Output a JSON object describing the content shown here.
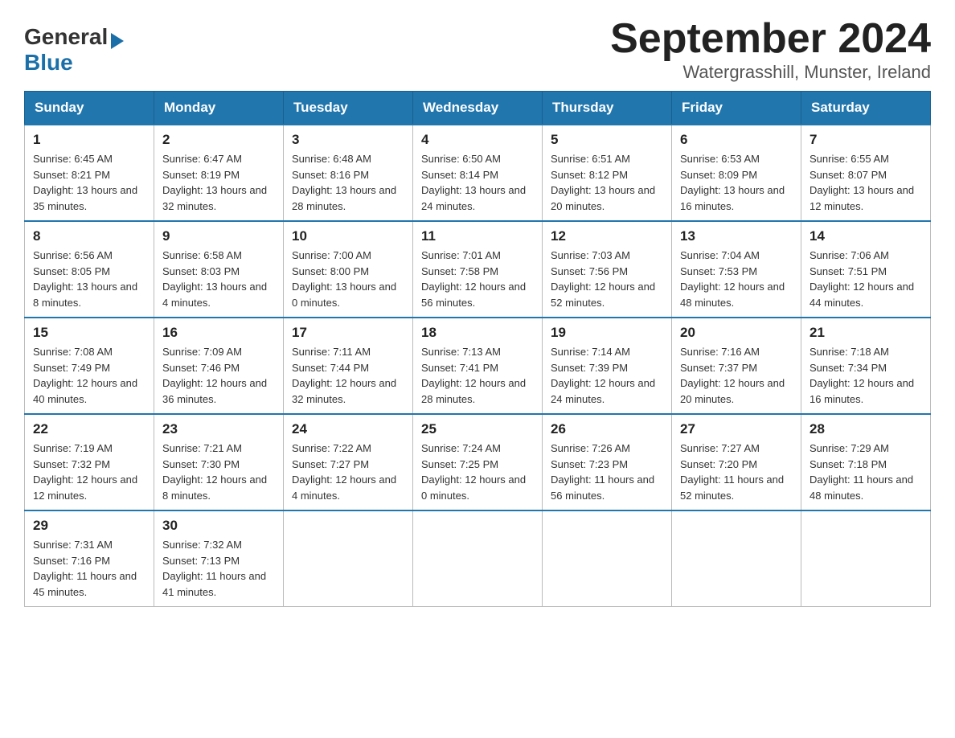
{
  "logo": {
    "general": "General",
    "blue": "Blue"
  },
  "title": "September 2024",
  "subtitle": "Watergrasshill, Munster, Ireland",
  "headers": [
    "Sunday",
    "Monday",
    "Tuesday",
    "Wednesday",
    "Thursday",
    "Friday",
    "Saturday"
  ],
  "weeks": [
    [
      {
        "day": "1",
        "sunrise": "6:45 AM",
        "sunset": "8:21 PM",
        "daylight": "13 hours and 35 minutes."
      },
      {
        "day": "2",
        "sunrise": "6:47 AM",
        "sunset": "8:19 PM",
        "daylight": "13 hours and 32 minutes."
      },
      {
        "day": "3",
        "sunrise": "6:48 AM",
        "sunset": "8:16 PM",
        "daylight": "13 hours and 28 minutes."
      },
      {
        "day": "4",
        "sunrise": "6:50 AM",
        "sunset": "8:14 PM",
        "daylight": "13 hours and 24 minutes."
      },
      {
        "day": "5",
        "sunrise": "6:51 AM",
        "sunset": "8:12 PM",
        "daylight": "13 hours and 20 minutes."
      },
      {
        "day": "6",
        "sunrise": "6:53 AM",
        "sunset": "8:09 PM",
        "daylight": "13 hours and 16 minutes."
      },
      {
        "day": "7",
        "sunrise": "6:55 AM",
        "sunset": "8:07 PM",
        "daylight": "13 hours and 12 minutes."
      }
    ],
    [
      {
        "day": "8",
        "sunrise": "6:56 AM",
        "sunset": "8:05 PM",
        "daylight": "13 hours and 8 minutes."
      },
      {
        "day": "9",
        "sunrise": "6:58 AM",
        "sunset": "8:03 PM",
        "daylight": "13 hours and 4 minutes."
      },
      {
        "day": "10",
        "sunrise": "7:00 AM",
        "sunset": "8:00 PM",
        "daylight": "13 hours and 0 minutes."
      },
      {
        "day": "11",
        "sunrise": "7:01 AM",
        "sunset": "7:58 PM",
        "daylight": "12 hours and 56 minutes."
      },
      {
        "day": "12",
        "sunrise": "7:03 AM",
        "sunset": "7:56 PM",
        "daylight": "12 hours and 52 minutes."
      },
      {
        "day": "13",
        "sunrise": "7:04 AM",
        "sunset": "7:53 PM",
        "daylight": "12 hours and 48 minutes."
      },
      {
        "day": "14",
        "sunrise": "7:06 AM",
        "sunset": "7:51 PM",
        "daylight": "12 hours and 44 minutes."
      }
    ],
    [
      {
        "day": "15",
        "sunrise": "7:08 AM",
        "sunset": "7:49 PM",
        "daylight": "12 hours and 40 minutes."
      },
      {
        "day": "16",
        "sunrise": "7:09 AM",
        "sunset": "7:46 PM",
        "daylight": "12 hours and 36 minutes."
      },
      {
        "day": "17",
        "sunrise": "7:11 AM",
        "sunset": "7:44 PM",
        "daylight": "12 hours and 32 minutes."
      },
      {
        "day": "18",
        "sunrise": "7:13 AM",
        "sunset": "7:41 PM",
        "daylight": "12 hours and 28 minutes."
      },
      {
        "day": "19",
        "sunrise": "7:14 AM",
        "sunset": "7:39 PM",
        "daylight": "12 hours and 24 minutes."
      },
      {
        "day": "20",
        "sunrise": "7:16 AM",
        "sunset": "7:37 PM",
        "daylight": "12 hours and 20 minutes."
      },
      {
        "day": "21",
        "sunrise": "7:18 AM",
        "sunset": "7:34 PM",
        "daylight": "12 hours and 16 minutes."
      }
    ],
    [
      {
        "day": "22",
        "sunrise": "7:19 AM",
        "sunset": "7:32 PM",
        "daylight": "12 hours and 12 minutes."
      },
      {
        "day": "23",
        "sunrise": "7:21 AM",
        "sunset": "7:30 PM",
        "daylight": "12 hours and 8 minutes."
      },
      {
        "day": "24",
        "sunrise": "7:22 AM",
        "sunset": "7:27 PM",
        "daylight": "12 hours and 4 minutes."
      },
      {
        "day": "25",
        "sunrise": "7:24 AM",
        "sunset": "7:25 PM",
        "daylight": "12 hours and 0 minutes."
      },
      {
        "day": "26",
        "sunrise": "7:26 AM",
        "sunset": "7:23 PM",
        "daylight": "11 hours and 56 minutes."
      },
      {
        "day": "27",
        "sunrise": "7:27 AM",
        "sunset": "7:20 PM",
        "daylight": "11 hours and 52 minutes."
      },
      {
        "day": "28",
        "sunrise": "7:29 AM",
        "sunset": "7:18 PM",
        "daylight": "11 hours and 48 minutes."
      }
    ],
    [
      {
        "day": "29",
        "sunrise": "7:31 AM",
        "sunset": "7:16 PM",
        "daylight": "11 hours and 45 minutes."
      },
      {
        "day": "30",
        "sunrise": "7:32 AM",
        "sunset": "7:13 PM",
        "daylight": "11 hours and 41 minutes."
      },
      null,
      null,
      null,
      null,
      null
    ]
  ]
}
